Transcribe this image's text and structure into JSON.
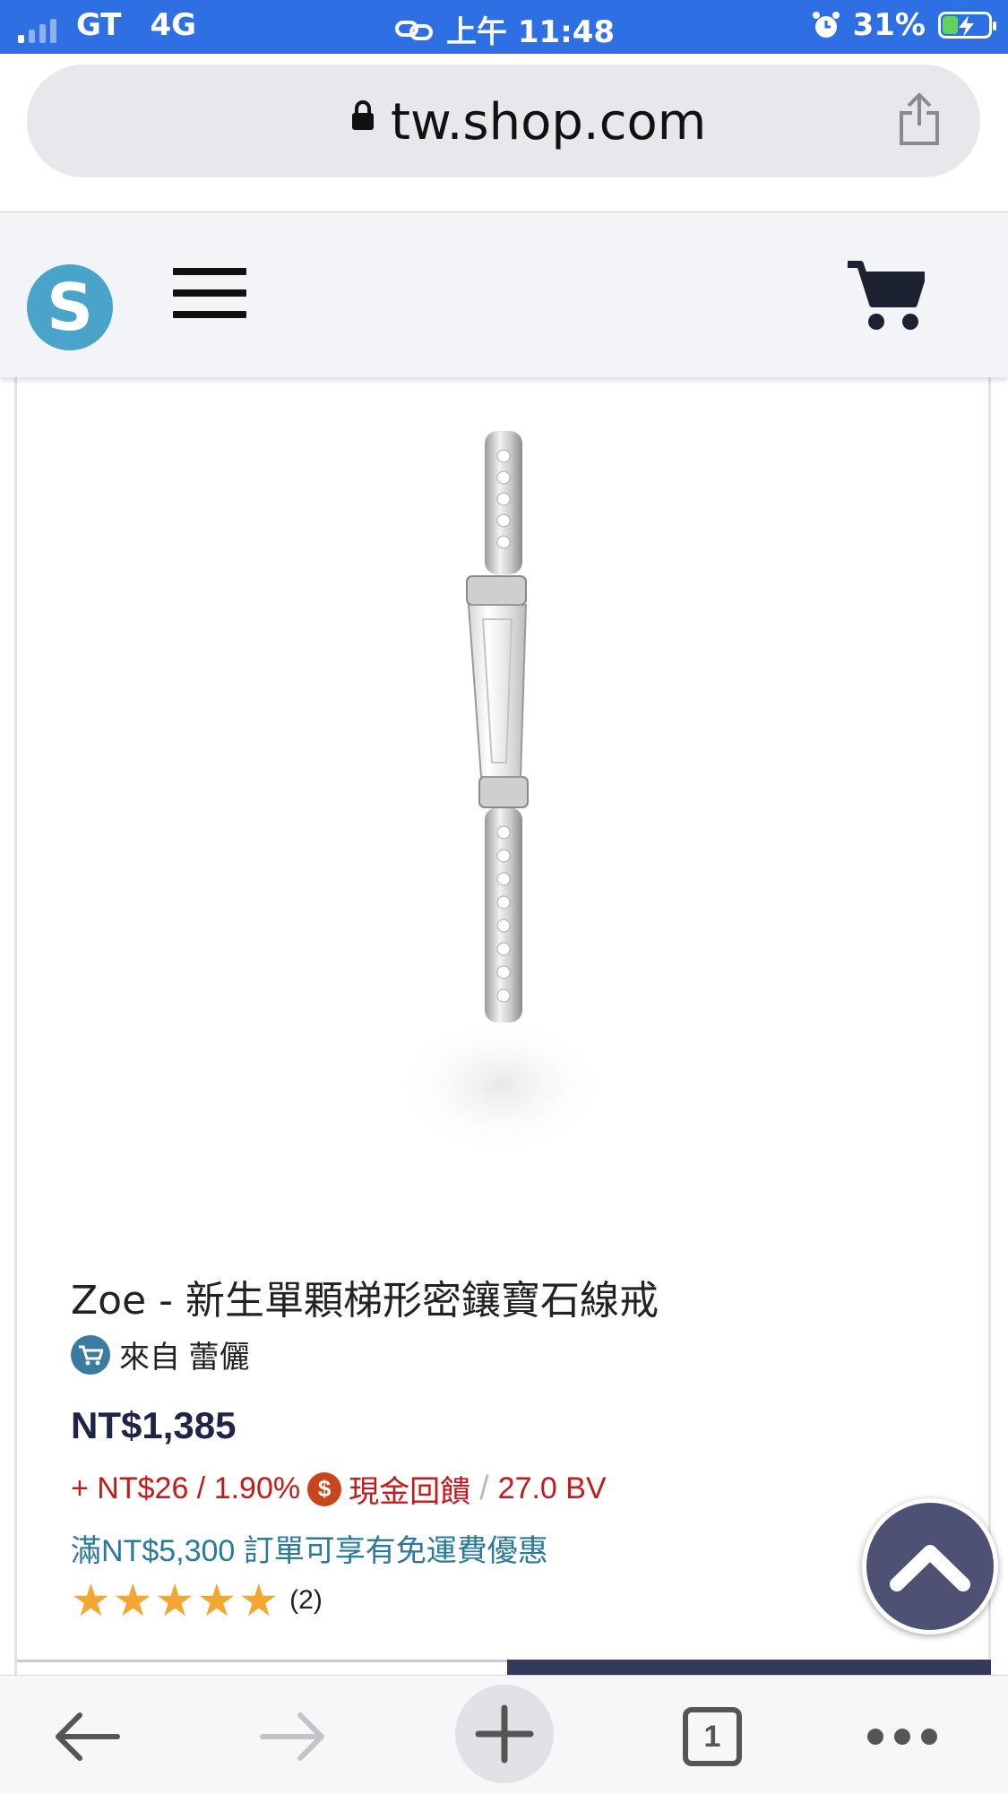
{
  "status_bar": {
    "carrier": "GT",
    "network": "4G",
    "time": "上午 11:48",
    "battery_percent": "31%",
    "battery_level": 0.31,
    "accent_color": "#2f6fe4"
  },
  "browser": {
    "url_domain": "tw.shop.com",
    "tab_count": "1"
  },
  "site_header": {
    "logo_letter": "S",
    "logo_color": "#4aa3c8",
    "icons": [
      "menu-icon",
      "cart-icon"
    ]
  },
  "product": {
    "title": "Zoe - 新生單顆梯形密鑲寶石線戒",
    "seller": "來自 蕾儷",
    "price": "NT$1,385",
    "cashback_amount": "+ NT$26 / 1.90%",
    "cashback_label": "現金回饋",
    "bv": "27.0 BV",
    "shipping_note": "滿NT$5,300 訂單可享有免運費優惠",
    "rating_stars": 5,
    "rating_count": "(2)",
    "price_color": "#1f2547",
    "cashback_color": "#c41a1a",
    "shipping_color": "#2b7a9a",
    "star_color": "#f3a630"
  }
}
